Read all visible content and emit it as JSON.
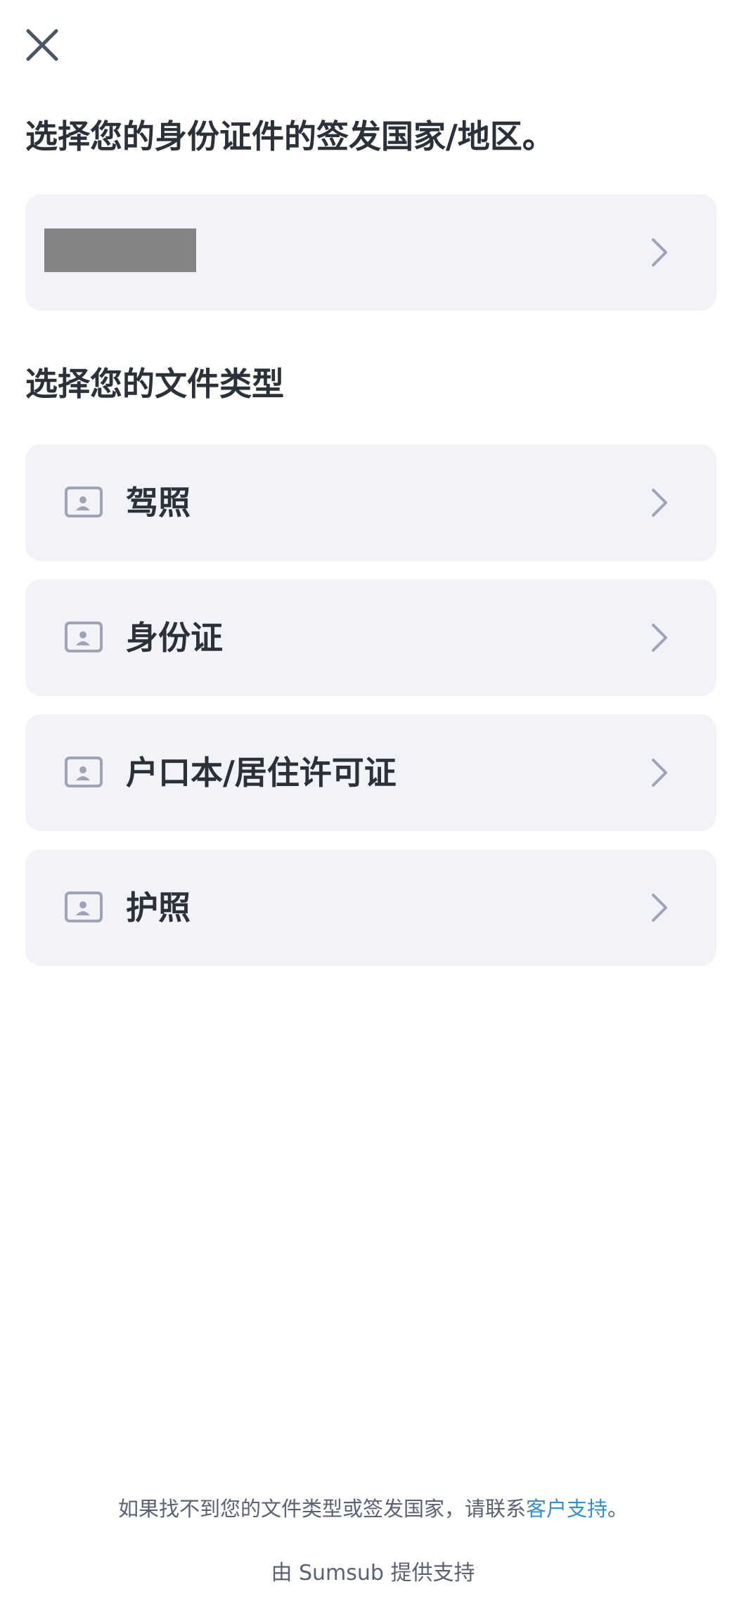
{
  "header": {
    "close_icon": "close-icon"
  },
  "country_section": {
    "title": "选择您的身份证件的签发国家/地区。",
    "selected_country": "",
    "chevron_icon": "chevron-right-icon"
  },
  "doc_section": {
    "title": "选择您的文件类型",
    "items": [
      {
        "label": "驾照",
        "icon": "id-card-icon"
      },
      {
        "label": "身份证",
        "icon": "id-card-icon"
      },
      {
        "label": "户口本/居住许可证",
        "icon": "id-card-icon"
      },
      {
        "label": "护照",
        "icon": "id-card-icon"
      }
    ]
  },
  "footer": {
    "help_text": "如果找不到您的文件类型或签发国家，请联系",
    "help_link": "客户支持",
    "help_end": "。",
    "powered_by": "由 Sumsub 提供支持"
  },
  "colors": {
    "row_bg": "#f2f3f8",
    "text": "#2b3139",
    "icon": "#9ea3b5",
    "link": "#3a8ec8"
  }
}
